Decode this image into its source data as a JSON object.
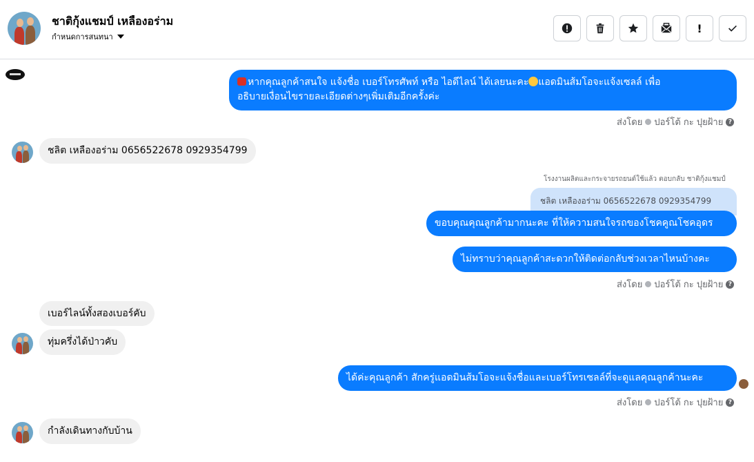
{
  "header": {
    "title": "ชาติกุ้งแชมป์ เหลืองอร่าม",
    "subtitle": "กำหนดการสนทนา",
    "tools": [
      {
        "icon": "alert-circle-icon"
      },
      {
        "icon": "trash-icon"
      },
      {
        "icon": "star-icon"
      },
      {
        "icon": "mail-icon"
      },
      {
        "icon": "exclamation-icon",
        "label": "!"
      },
      {
        "icon": "check-icon"
      }
    ]
  },
  "messages": {
    "m1_emoji": "☎",
    "m1_line1": "หากคุณลูกค้าสนใจ แจ้งชื่อ เบอร์โทรศัพท์ หรือ ไอดีไลน์  ได้เลยนะคะ",
    "m1_line1b": "แอดมินส้มโอจะแจ้งเซลล์  เพื่อ",
    "m1_line2": "อธิบายเงื่อนไขรายละเอียดต่างๆเพิ่มเติมอีกครั้งค่ะ",
    "sent_by_prefix": "ส่งโดย",
    "sent_by_name": "ปอร์โต้ กะ ปุยฝ้าย",
    "help": "?",
    "in1": "ชลิต  เหลืองอร่าม  0656522678   0929354799",
    "reply_note": "โรงงานผลิตและกระจายรถยนต์ใช้แล้ว ตอบกลับ ชาติกุ้งแชมป์",
    "quote": "ชลิต เหลืองอร่าม 0656522678 0929354799",
    "out2": "ขอบคุณคุณลูกค้ามากนะคะ ที่ให้ความสนใจรถของโชคคูณโชคอุดร",
    "out3": "ไม่ทราบว่าคุณลูกค้าสะดวกให้ติดต่อกลับช่วงเวลาไหนบ้างคะ",
    "in2": "เบอร์ไลน์ทั้งสองเบอร์คับ",
    "in3": "ทุ่มครึ่งได้ป่าวคับ",
    "out4": "ได้ค่ะคุณลูกค้า สักครู่แอดมินส้มโอจะแจ้งชื่อและเบอร์โทรเซลล์ที่จะดูแลคุณลูกค้านะคะ",
    "in4": "กำลังเดินทางกับบ้าน"
  },
  "colors": {
    "outgoing": "#0a7cff",
    "incoming": "#f0f0f0",
    "quote": "#cfe3fb",
    "meta": "#65676b"
  }
}
